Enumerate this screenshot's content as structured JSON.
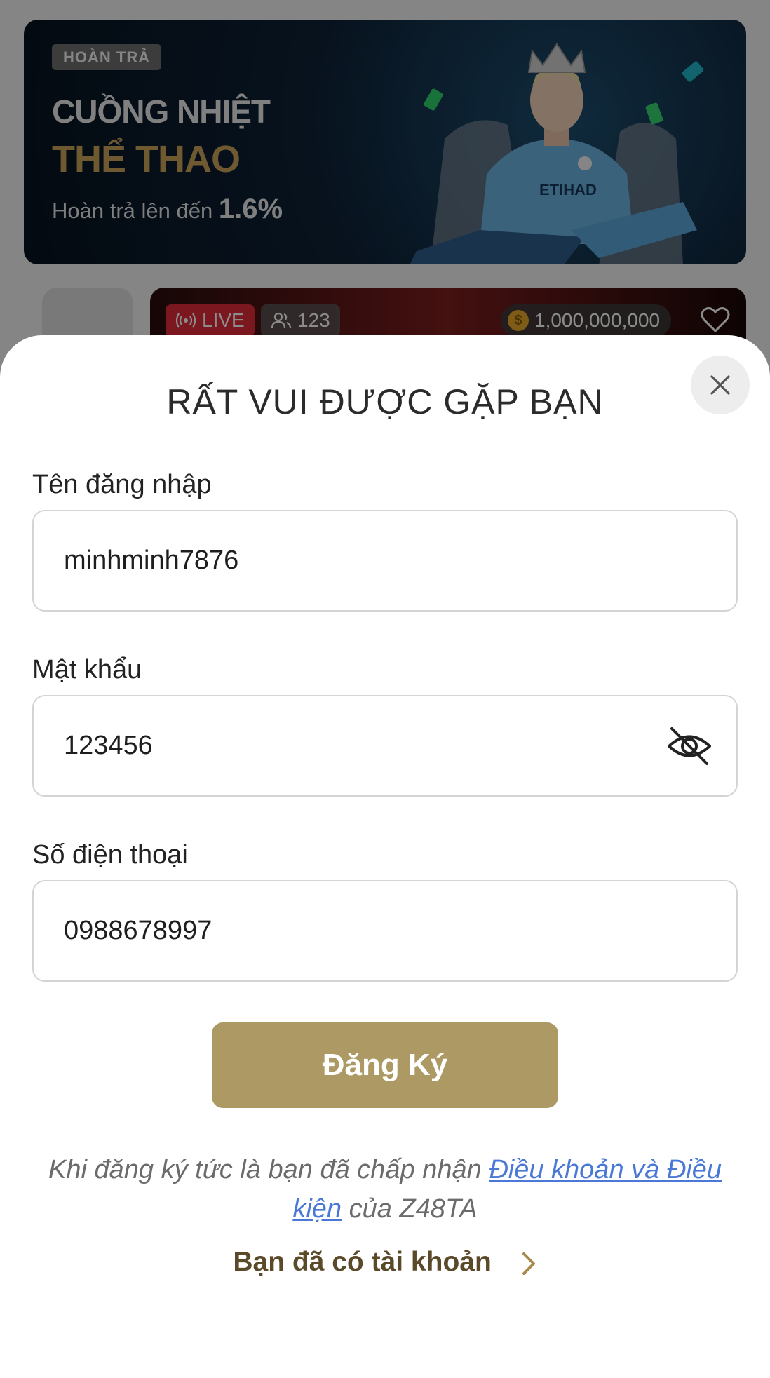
{
  "background": {
    "promo": {
      "badge": "HOÀN TRẢ",
      "title_line1": "CUỒNG NHIỆT",
      "title_line2": "THỂ THAO",
      "subtitle_prefix": "Hoàn trả lên đến",
      "subtitle_value": "1.6%"
    },
    "live_card": {
      "live_label": "LIVE",
      "viewers": "123",
      "coins": "1,000,000,000"
    }
  },
  "modal": {
    "title": "RẤT VUI ĐƯỢC GẶP BẠN",
    "username": {
      "label": "Tên đăng nhập",
      "value": "minhminh7876"
    },
    "password": {
      "label": "Mật khẩu",
      "value": "123456"
    },
    "phone": {
      "label": "Số điện thoại",
      "value": "0988678997"
    },
    "submit_label": "Đăng Ký",
    "terms": {
      "prefix": "Khi đăng ký tức là bạn đã chấp nhận ",
      "link": "Điều khoản và Điều kiện",
      "suffix": " của Z48TA"
    },
    "login_link": "Bạn đã có tài khoản"
  },
  "colors": {
    "accent": "#ac9964",
    "link": "#4a78d6",
    "live": "#e02a3a"
  }
}
